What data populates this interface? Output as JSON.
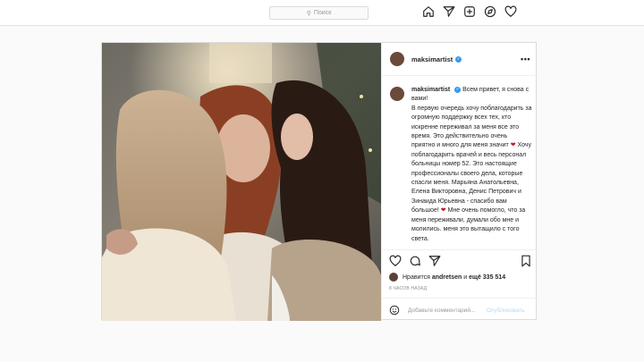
{
  "search": {
    "placeholder": "Поиск",
    "icon": "search-icon"
  },
  "nav": {
    "icons": [
      "home-icon",
      "direct-icon",
      "new-post-icon",
      "explore-icon",
      "activity-heart-icon"
    ]
  },
  "post": {
    "username": "maksimartist",
    "verified": true,
    "caption_username": "maksimartist",
    "caption_text": "Всем привет, я снова с вами!\nВ первую очередь хочу поблагодарить за огромную поддержку всех тех, кто искренне переживал за меня все это время. Это действительно очень приятно и много для меня значит ",
    "caption_text_2": " Хочу поблагодарить врачей и весь персонал больницы номер 52. Это настоящие профессионалы своего дела, которые спасли меня. Марьяна Анатольевна, Елена Викторовна, Денис Петрович и Зинаида Юрьевна - спасибо вам большое! ",
    "caption_text_3": " Мне очень помогло, что за меня переживали, думали обо мне и молились. меня это вытащило с того света.",
    "heart_emoji": "❤",
    "likes_prefix": "Нравится",
    "likes_user": "andretsen",
    "likes_mid": "и",
    "likes_count": "ещё 335 514",
    "time": "8 ЧАСОВ НАЗАД",
    "comment_placeholder": "Добавьте комментарий...",
    "publish_label": "Опубликовать",
    "more_label": "•••"
  },
  "colors": {
    "accent_link": "#3897f0",
    "publish_disabled": "#b3d9fb",
    "heart": "#c3172b"
  }
}
